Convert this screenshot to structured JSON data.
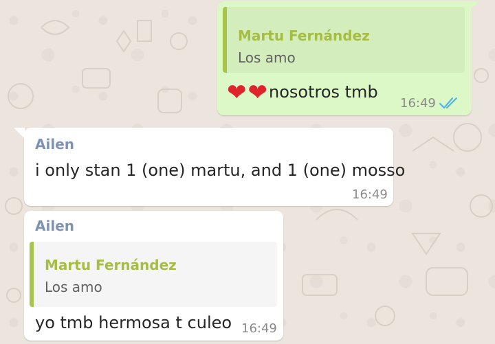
{
  "app": {
    "accent_outgoing": "#dcf8c6",
    "accent_incoming": "#ffffff",
    "wallpaper": "#ece5dd",
    "sender_color": "#7e93b3",
    "quote_color": "#a9c44b",
    "read_tick_color": "#4fb6ec"
  },
  "messages": [
    {
      "direction": "outgoing",
      "quote": {
        "author": "Martu Fernández",
        "text": "Los amo"
      },
      "emoji": [
        "heart-emoji",
        "heart-emoji"
      ],
      "emoji_glyph": "❤",
      "text": "nosotros tmb",
      "time": "16:49",
      "status_icon": "double-check-read-icon"
    },
    {
      "direction": "incoming",
      "sender": "Ailen",
      "text": "i only stan 1 (one) martu, and 1 (one) mosso",
      "time": "16:49"
    },
    {
      "direction": "incoming",
      "sender": "Ailen",
      "quote": {
        "author": "Martu Fernández",
        "text": "Los amo"
      },
      "text": "yo tmb hermosa t culeo",
      "time": "16:49"
    }
  ]
}
